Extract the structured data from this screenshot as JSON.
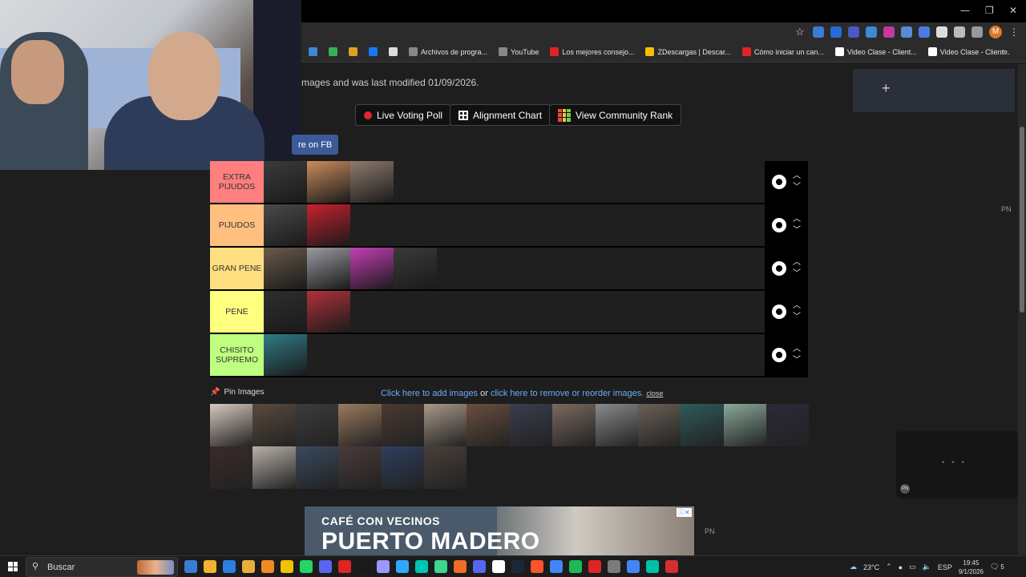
{
  "window": {
    "min": "—",
    "max": "❐",
    "close": "✕"
  },
  "bookmarks": [
    {
      "label": "Archivos de progra...",
      "color": "#888888"
    },
    {
      "label": "YouTube",
      "color": "#888888"
    },
    {
      "label": "Los mejores consejo...",
      "color": "#e02424"
    },
    {
      "label": "ZDescargas | Descar...",
      "color": "#f2c200"
    },
    {
      "label": "Cómo iniciar un can...",
      "color": "#e02424"
    },
    {
      "label": "Video Clase - Client...",
      "color": "#ffffff"
    },
    {
      "label": "Video Clase - Client...",
      "color": "#ffffff"
    }
  ],
  "bookmarks_more": "»",
  "profile_initial": "M",
  "page": {
    "subtitle": "mages and was last modified 01/09/2026.",
    "live_voting_label": "Live Voting Poll",
    "alignment_label": "Alignment Chart",
    "community_label": "View Community Rank",
    "fb_label": "re on FB"
  },
  "tiers": [
    {
      "label": "EXTRA PIJUDOS",
      "color": "#ff7f7f",
      "items": [
        "#3b3b3b",
        "#c98d5e",
        "#8f7a6e"
      ]
    },
    {
      "label": "PIJUDOS",
      "color": "#ffbf7f",
      "items": [
        "#4a4a4a",
        "#c8202e"
      ]
    },
    {
      "label": "GRAN PENE",
      "color": "#ffdf7f",
      "items": [
        "#6a5a4c",
        "#9a9aa2",
        "#c43fb5",
        "#3a3a3a"
      ]
    },
    {
      "label": "PENE",
      "color": "#ffff7f",
      "items": [
        "#2e2e2e",
        "#b0323a"
      ]
    },
    {
      "label": "CHISITO SUPREMO",
      "color": "#bfff7f",
      "items": [
        "#2f7d86"
      ]
    }
  ],
  "pin": {
    "label": "Pin Images",
    "add_link": "Click here to add images",
    "or_text": " or ",
    "remove_link": "click here to remove or reorder images.",
    "close": "close"
  },
  "pool": [
    "#d8c8c0",
    "#5a4a3e",
    "#3c3c3c",
    "#9a7a5e",
    "#4a3a30",
    "#a89888",
    "#6a4e3e",
    "#3a3e4e",
    "#7a6a5e",
    "#8a8a8a",
    "#6a6058",
    "#2e5a5a",
    "#8aa89a",
    "#2a2a3a",
    "#3a2a2a",
    "#b8b0a8",
    "#3a4a5e",
    "#4a3a3a",
    "#2e3e5e",
    "#4a3e3a"
  ],
  "ads": {
    "pn": "PN",
    "video_dots": "• • •",
    "banner_sub": "CAFÉ CON VECINOS",
    "banner_title": "PUERTO MADERO",
    "banner_badge": "ⓘ✕"
  },
  "taskbar": {
    "search_placeholder": "Buscar",
    "weather": "23°C",
    "lang": "ESP",
    "time": "19:45",
    "date": "9/1/2026",
    "notifications": "5",
    "apps": [
      "#3a7bd5",
      "#f2b233",
      "#2d7de0",
      "#e8b03a",
      "#f08a24",
      "#f2c200",
      "#25d366",
      "#5865f2",
      "#e02424",
      "#1a1a1a",
      "#9999ff",
      "#31a8ff",
      "#00c4b4",
      "#3dd68c",
      "#f06a2a",
      "#5865f2",
      "#ffffff",
      "#1b2838",
      "#fb542b",
      "#4285f4",
      "#1db954",
      "#e02424",
      "#7a7a7a",
      "#4285f4",
      "#00bfa5",
      "#d32f2f"
    ]
  }
}
